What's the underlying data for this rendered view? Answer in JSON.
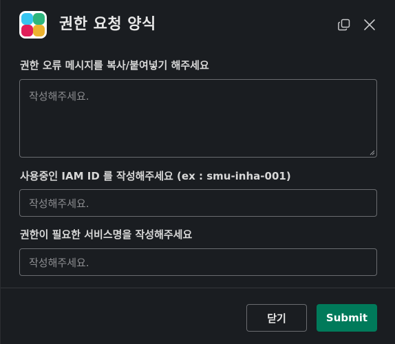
{
  "header": {
    "title": "권한 요청 양식",
    "expand_icon": "expand-icon",
    "close_icon": "close-icon"
  },
  "fields": [
    {
      "label": "권한 오류 메시지를 복사/붙여넣기 해주세요",
      "placeholder": "작성해주세요.",
      "value": ""
    },
    {
      "label": "사용중인 IAM ID 를 작성해주세요 (ex : smu-inha-001)",
      "placeholder": "작성해주세요.",
      "value": ""
    },
    {
      "label": "권한이 필요한 서비스명을 작성해주세요",
      "placeholder": "작성해주세요.",
      "value": ""
    }
  ],
  "footer": {
    "close_label": "닫기",
    "submit_label": "Submit"
  },
  "colors": {
    "background": "#1a1d21",
    "border": "#6b6d71",
    "submit": "#007a5a",
    "logo_blue": "#36c5f0",
    "logo_green": "#2eb67d",
    "logo_red": "#e01e5a",
    "logo_yellow": "#ecb22e"
  }
}
